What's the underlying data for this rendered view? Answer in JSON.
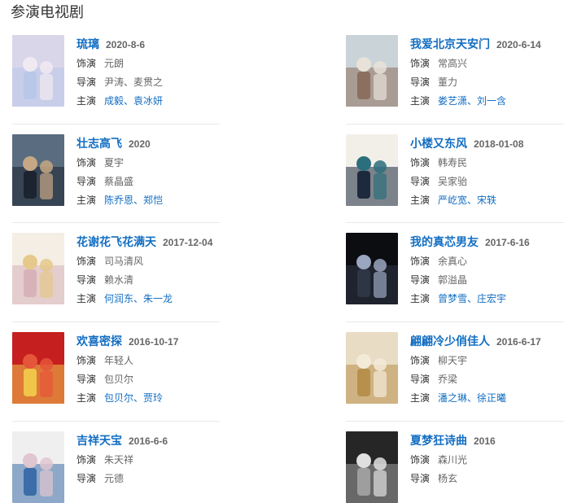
{
  "section_title": "参演电视剧",
  "labels": {
    "role": "饰演",
    "director": "导演",
    "stars": "主演",
    "sep": "、"
  },
  "shows": [
    {
      "title": "琉璃",
      "date": "2020-8-6",
      "role": "元朗",
      "directors": "尹涛、麦贯之",
      "stars": [
        "成毅",
        "袁冰妍"
      ],
      "poster": [
        "#d9d6ea",
        "#b9c8e8",
        "#f1e9f1"
      ]
    },
    {
      "title": "我爱北京天安门",
      "date": "2020-6-14",
      "role": "常高兴",
      "directors": "董力",
      "stars": [
        "娄艺潇",
        "刘一含"
      ],
      "poster": [
        "#c9d3d8",
        "#8c6f5e",
        "#e8e2d8"
      ]
    },
    {
      "title": "壮志高飞",
      "date": "2020",
      "role": "夏宇",
      "directors": "蔡晶盛",
      "stars": [
        "陈乔恩",
        "郑恺"
      ],
      "poster": [
        "#5a6c80",
        "#1c2430",
        "#c7a884"
      ]
    },
    {
      "title": "小楼又东风",
      "date": "2018-01-08",
      "role": "韩寿民",
      "directors": "吴家骀",
      "stars": [
        "严屹宽",
        "宋轶"
      ],
      "poster": [
        "#f2efe9",
        "#1d2a3e",
        "#2c6f7c"
      ]
    },
    {
      "title": "花谢花飞花满天",
      "date": "2017-12-04",
      "role": "司马清风",
      "directors": "赖水清",
      "stars": [
        "何润东",
        "朱一龙"
      ],
      "poster": [
        "#f4eee4",
        "#d7b3b9",
        "#e5c88a"
      ]
    },
    {
      "title": "我的真芯男友",
      "date": "2017-6-16",
      "role": "余真心",
      "directors": "郭溢晶",
      "stars": [
        "曾梦雪",
        "庄宏宇"
      ],
      "poster": [
        "#0c0d11",
        "#2e3646",
        "#9aa6bf"
      ]
    },
    {
      "title": "欢喜密探",
      "date": "2016-10-17",
      "role": "年轻人",
      "directors": "包贝尔",
      "stars": [
        "包贝尔",
        "贾玲"
      ],
      "poster": [
        "#c61f1f",
        "#f1c44a",
        "#e5553a"
      ]
    },
    {
      "title": "翩翩冷少俏佳人",
      "date": "2016-6-17",
      "role": "柳天宇",
      "directors": "乔梁",
      "stars": [
        "潘之琳",
        "徐正曦"
      ],
      "poster": [
        "#e9dcc4",
        "#b8904d",
        "#f3ead8"
      ]
    },
    {
      "title": "吉祥天宝",
      "date": "2016-6-6",
      "role": "朱天祥",
      "directors": "元德",
      "stars": [],
      "poster": [
        "#f0eff0",
        "#3d6da8",
        "#dfc6d0"
      ]
    },
    {
      "title": "夏梦狂诗曲",
      "date": "2016",
      "role": "森川光",
      "directors": "杨玄",
      "stars": [],
      "poster": [
        "#262626",
        "#9e9e9e",
        "#e0e0e0"
      ]
    }
  ]
}
